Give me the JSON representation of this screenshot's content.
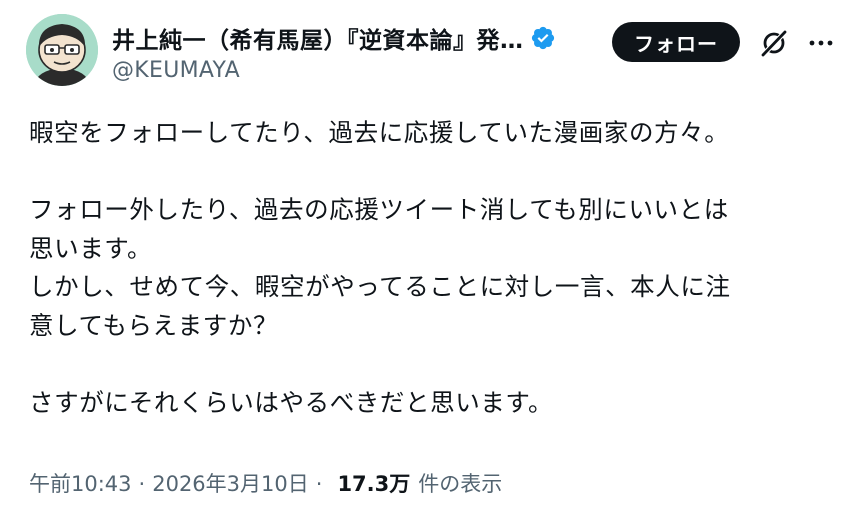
{
  "author": {
    "display_name": "井上純一（希有馬屋）『逆資本論』発…",
    "handle": "@KEUMAYA",
    "verified": true,
    "avatar_icon": "avatar-illustration-icon"
  },
  "actions": {
    "follow_label": "フォロー",
    "grok_icon": "grok-icon",
    "more_icon": "more-options-icon"
  },
  "tweet": {
    "paragraphs": [
      [
        "暇空をフォローしてたり、過去に応援していた漫画家の方々。"
      ],
      [
        "フォロー外したり、過去の応援ツイート消しても別にいいとは",
        "思います。",
        "しかし、せめて今、暇空がやってることに対し一言、本人に注",
        "意してもらえますか？"
      ],
      [
        "さすがにそれくらいはやるべきだと思います。"
      ]
    ]
  },
  "meta": {
    "time": "午前10:43",
    "separator": "·",
    "date": "2026年3月10日",
    "views_count": "17.3万",
    "views_label": "件の表示"
  },
  "colors": {
    "text_primary": "#0f1419",
    "text_secondary": "#536471",
    "verified_blue": "#1d9bf0",
    "follow_bg": "#0f1419",
    "avatar_bg": "#a8dcc9"
  }
}
